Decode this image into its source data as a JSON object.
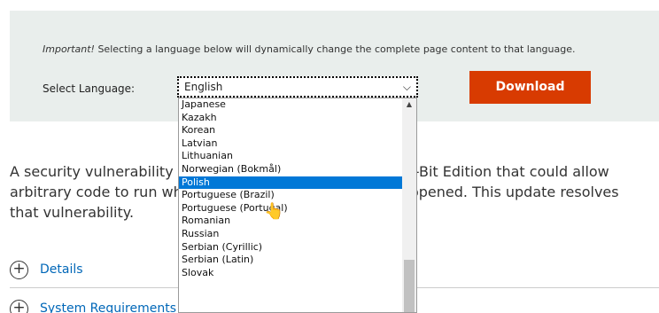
{
  "language_panel": {
    "notice_important": "Important!",
    "notice_text": " Selecting a language below will dynamically change the complete page content to that language.",
    "select_label": "Select Language:",
    "selected_language": "English",
    "download_label": "Download"
  },
  "description": {
    "line1": "A security vulnerability exists in Microsoft Office 2016 64-Bit Edition that could allow",
    "line2": "arbitrary code to run when a maliciously modified file is opened. This update resolves",
    "line3": "that vulnerability."
  },
  "sections": {
    "details": "Details",
    "system_requirements": "System Requirements"
  },
  "dropdown": {
    "options": [
      "Japanese",
      "Kazakh",
      "Korean",
      "Latvian",
      "Lithuanian",
      "Norwegian (Bokmål)",
      "Polish",
      "Portuguese (Brazil)",
      "Portuguese (Portugal)",
      "Romanian",
      "Russian",
      "Serbian (Cyrillic)",
      "Serbian (Latin)",
      "Slovak"
    ],
    "highlighted": "Polish"
  },
  "colors": {
    "download": "#d83b01",
    "highlight": "#0078d7",
    "link": "#0067b8",
    "panel": "#e9eeec"
  }
}
